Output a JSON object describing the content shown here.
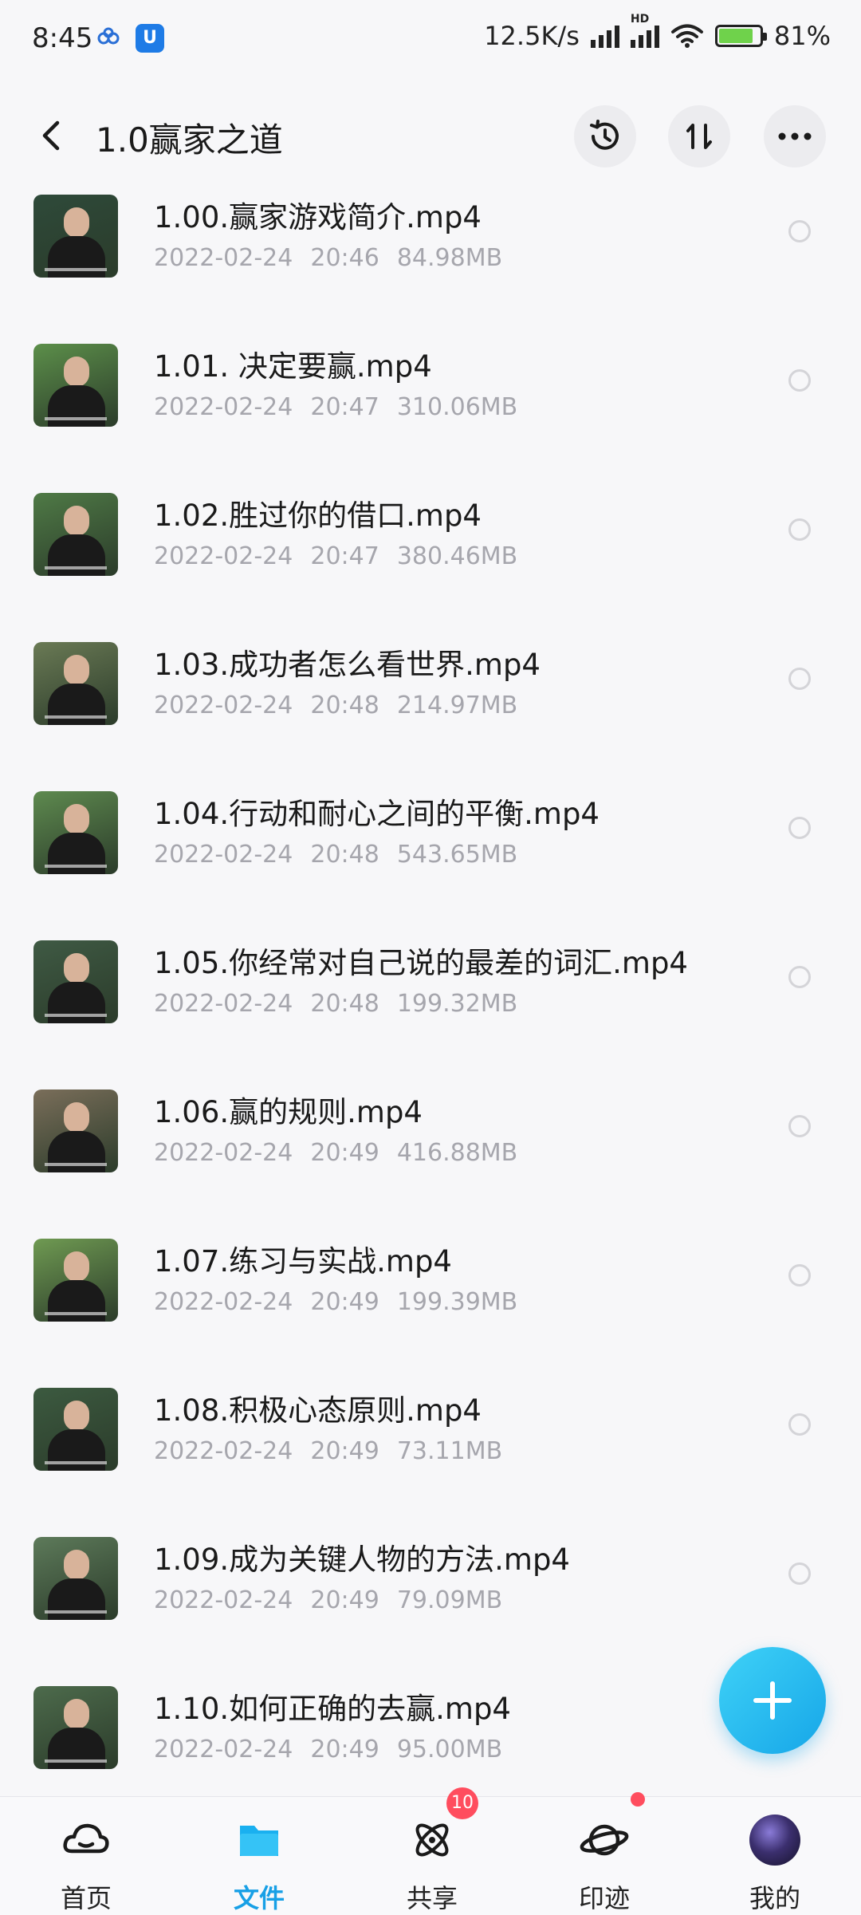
{
  "status_bar": {
    "time": "8:45",
    "network_speed": "12.5K/s",
    "battery": "81%",
    "hd_label": "HD"
  },
  "header": {
    "title": "1.0赢家之道",
    "icons": [
      "back-icon",
      "history-icon",
      "sort-icon",
      "more-icon"
    ]
  },
  "files": [
    {
      "name": "1.00.赢家游戏简介.mp4",
      "date": "2022-02-24",
      "time": "20:46",
      "size": "84.98MB"
    },
    {
      "name": "1.01. 决定要赢.mp4",
      "date": "2022-02-24",
      "time": "20:47",
      "size": "310.06MB"
    },
    {
      "name": "1.02.胜过你的借口.mp4",
      "date": "2022-02-24",
      "time": "20:47",
      "size": "380.46MB"
    },
    {
      "name": "1.03.成功者怎么看世界.mp4",
      "date": "2022-02-24",
      "time": "20:48",
      "size": "214.97MB"
    },
    {
      "name": "1.04.行动和耐心之间的平衡.mp4",
      "date": "2022-02-24",
      "time": "20:48",
      "size": "543.65MB"
    },
    {
      "name": "1.05.你经常对自己说的最差的词汇.mp4",
      "date": "2022-02-24",
      "time": "20:48",
      "size": "199.32MB"
    },
    {
      "name": "1.06.赢的规则.mp4",
      "date": "2022-02-24",
      "time": "20:49",
      "size": "416.88MB"
    },
    {
      "name": "1.07.练习与实战.mp4",
      "date": "2022-02-24",
      "time": "20:49",
      "size": "199.39MB"
    },
    {
      "name": "1.08.积极心态原则.mp4",
      "date": "2022-02-24",
      "time": "20:49",
      "size": "73.11MB"
    },
    {
      "name": "1.09.成为关键人物的方法.mp4",
      "date": "2022-02-24",
      "time": "20:49",
      "size": "79.09MB"
    },
    {
      "name": "1.10.如何正确的去赢.mp4",
      "date": "2022-02-24",
      "time": "20:49",
      "size": "95.00MB"
    }
  ],
  "tabs": [
    {
      "label": "首页",
      "icon": "home-cloud-icon",
      "active": false
    },
    {
      "label": "文件",
      "icon": "folder-icon",
      "active": true
    },
    {
      "label": "共享",
      "icon": "share-atom-icon",
      "badge": "10"
    },
    {
      "label": "印迹",
      "icon": "planet-icon",
      "dot": true
    },
    {
      "label": "我的",
      "icon": "avatar-icon"
    }
  ],
  "colors": {
    "accent": "#18a0e6",
    "badge": "#ff4d5e",
    "meta_text": "#a6a6ad"
  }
}
